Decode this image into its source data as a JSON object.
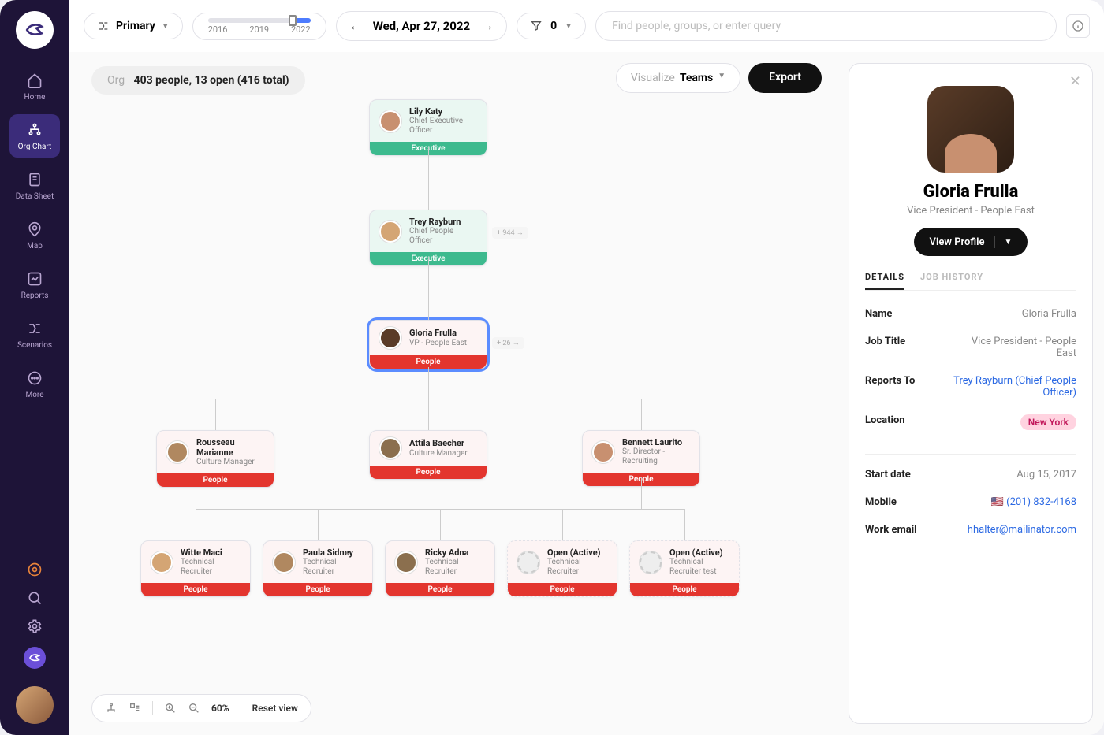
{
  "sidebar": {
    "items": [
      {
        "label": "Home"
      },
      {
        "label": "Org Chart"
      },
      {
        "label": "Data Sheet"
      },
      {
        "label": "Map"
      },
      {
        "label": "Reports"
      },
      {
        "label": "Scenarios"
      },
      {
        "label": "More"
      }
    ]
  },
  "topbar": {
    "scenario_label": "Primary",
    "timeline_years": [
      "2016",
      "2019",
      "2022"
    ],
    "date": "Wed, Apr 27, 2022",
    "filter_count": "0",
    "search_placeholder": "Find people, groups, or enter query"
  },
  "stats": {
    "prefix": "Org",
    "line": "403 people, 13 open (416 total)"
  },
  "controls": {
    "visualize_label": "Visualize",
    "visualize_value": "Teams",
    "export_label": "Export"
  },
  "org": {
    "nodes": [
      {
        "id": "n0",
        "name": "Lily Katy",
        "title": "Chief Executive Officer",
        "dept": "Executive",
        "dept_class": "dept-exec",
        "tint": "tint-exec"
      },
      {
        "id": "n1",
        "name": "Trey Rayburn",
        "title": "Chief People Officer",
        "dept": "Executive",
        "dept_class": "dept-exec",
        "tint": "tint-exec",
        "badge": "+ 944  →"
      },
      {
        "id": "n2",
        "name": "Gloria Frulla",
        "title": "VP - People East",
        "dept": "People",
        "dept_class": "dept-people",
        "tint": "tint-people",
        "selected": true,
        "badge": "+ 26  →"
      },
      {
        "id": "n3",
        "name": "Rousseau Marianne",
        "title": "Culture Manager",
        "dept": "People",
        "dept_class": "dept-people",
        "tint": "tint-people"
      },
      {
        "id": "n4",
        "name": "Attila Baecher",
        "title": "Culture Manager",
        "dept": "People",
        "dept_class": "dept-people",
        "tint": "tint-people"
      },
      {
        "id": "n5",
        "name": "Bennett Laurito",
        "title": "Sr. Director - Recruiting",
        "dept": "People",
        "dept_class": "dept-people",
        "tint": "tint-people"
      },
      {
        "id": "n6",
        "name": "Witte Maci",
        "title": "Technical Recruiter",
        "dept": "People",
        "dept_class": "dept-people",
        "tint": "tint-people"
      },
      {
        "id": "n7",
        "name": "Paula Sidney",
        "title": "Technical Recruiter",
        "dept": "People",
        "dept_class": "dept-people",
        "tint": "tint-people"
      },
      {
        "id": "n8",
        "name": "Ricky Adna",
        "title": "Technical Recruiter",
        "dept": "People",
        "dept_class": "dept-people",
        "tint": "tint-people"
      },
      {
        "id": "n9",
        "name": "Open (Active)",
        "title": "Technical Recruiter",
        "dept": "People",
        "dept_class": "dept-people",
        "open": true
      },
      {
        "id": "n10",
        "name": "Open (Active)",
        "title": "Technical Recruiter test",
        "dept": "People",
        "dept_class": "dept-people",
        "open": true
      }
    ]
  },
  "panel": {
    "name": "Gloria Frulla",
    "role": "Vice President - People East",
    "view_profile": "View Profile",
    "tabs": {
      "details": "DETAILS",
      "history": "JOB HISTORY"
    },
    "details": {
      "name_label": "Name",
      "name_value": "Gloria Frulla",
      "job_label": "Job Title",
      "job_value": "Vice President - People East",
      "reports_label": "Reports To",
      "reports_value": "Trey Rayburn (Chief People Officer)",
      "location_label": "Location",
      "location_value": "New York",
      "start_label": "Start date",
      "start_value": "Aug 15, 2017",
      "mobile_label": "Mobile",
      "mobile_flag": "🇺🇸",
      "mobile_value": "(201) 832-4168",
      "email_label": "Work email",
      "email_value": "hhalter@mailinator.com"
    }
  },
  "bottom": {
    "zoom": "60%",
    "reset": "Reset view"
  }
}
